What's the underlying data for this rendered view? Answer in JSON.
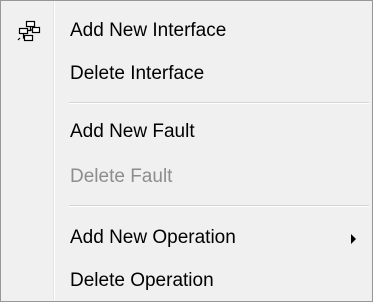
{
  "menu": {
    "items": [
      {
        "label": "Add New Interface",
        "icon": "interface-icon",
        "enabled": true
      },
      {
        "label": "Delete Interface",
        "enabled": true
      },
      {
        "label": "Add New Fault",
        "enabled": true
      },
      {
        "label": "Delete Fault",
        "enabled": false
      },
      {
        "label": "Add New Operation",
        "enabled": true,
        "submenu": true
      },
      {
        "label": "Delete Operation",
        "enabled": true
      }
    ]
  },
  "colors": {
    "background": "#f0f0f0",
    "border": "#979797",
    "disabled_text": "#8d8d8d",
    "separator": "#d5d5d5"
  }
}
